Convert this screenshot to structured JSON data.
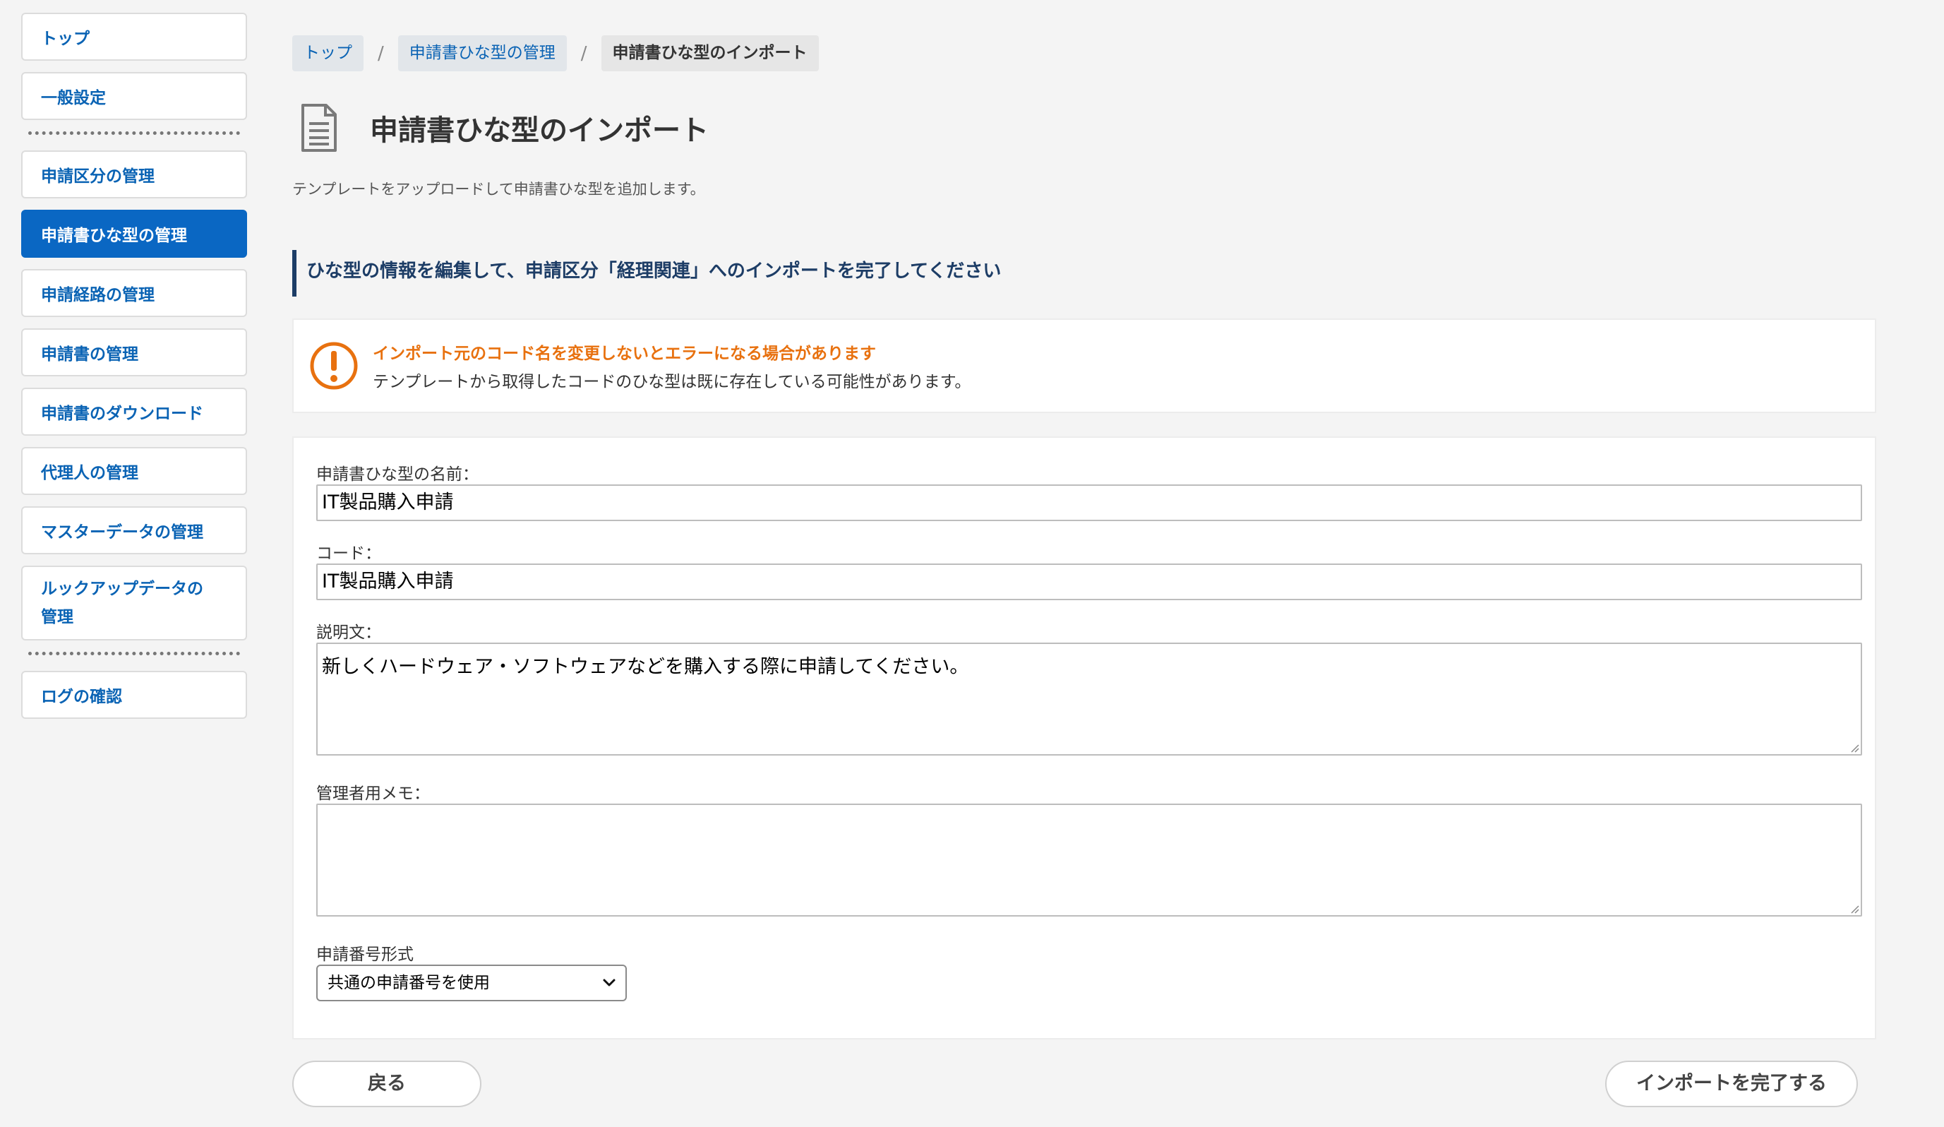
{
  "sidebar": {
    "items": [
      {
        "label": "トップ"
      },
      {
        "label": "一般設定"
      },
      {
        "label": "申請区分の管理"
      },
      {
        "label": "申請書ひな型の管理"
      },
      {
        "label": "申請経路の管理"
      },
      {
        "label": "申請書の管理"
      },
      {
        "label": "申請書のダウンロード"
      },
      {
        "label": "代理人の管理"
      },
      {
        "label": "マスターデータの管理"
      },
      {
        "label": "ルックアップデータの管理"
      },
      {
        "label": "ログの確認"
      }
    ],
    "active_index": 3
  },
  "breadcrumb": {
    "items": [
      "トップ",
      "申請書ひな型の管理",
      "申請書ひな型のインポート"
    ],
    "separator": "/"
  },
  "page": {
    "title": "申請書ひな型のインポート",
    "description": "テンプレートをアップロードして申請書ひな型を追加します。",
    "section_heading": "ひな型の情報を編集して、申請区分「経理関連」へのインポートを完了してください"
  },
  "warning": {
    "title": "インポート元のコード名を変更しないとエラーになる場合があります",
    "text": "テンプレートから取得したコードのひな型は既に存在している可能性があります。"
  },
  "form": {
    "name_label": "申請書ひな型の名前：",
    "name_value": "IT製品購入申請",
    "code_label": "コード：",
    "code_value": "IT製品購入申請",
    "desc_label": "説明文：",
    "desc_value": "新しくハードウェア・ソフトウェアなどを購入する際に申請してください。",
    "memo_label": "管理者用メモ：",
    "memo_value": "",
    "number_format_label": "申請番号形式",
    "number_format_selected": "共通の申請番号を使用"
  },
  "buttons": {
    "back": "戻る",
    "complete": "インポートを完了する"
  },
  "colors": {
    "accent": "#0a67c3",
    "link": "#0a63b4",
    "warning": "#e8710f",
    "heading": "#1d3d66"
  }
}
